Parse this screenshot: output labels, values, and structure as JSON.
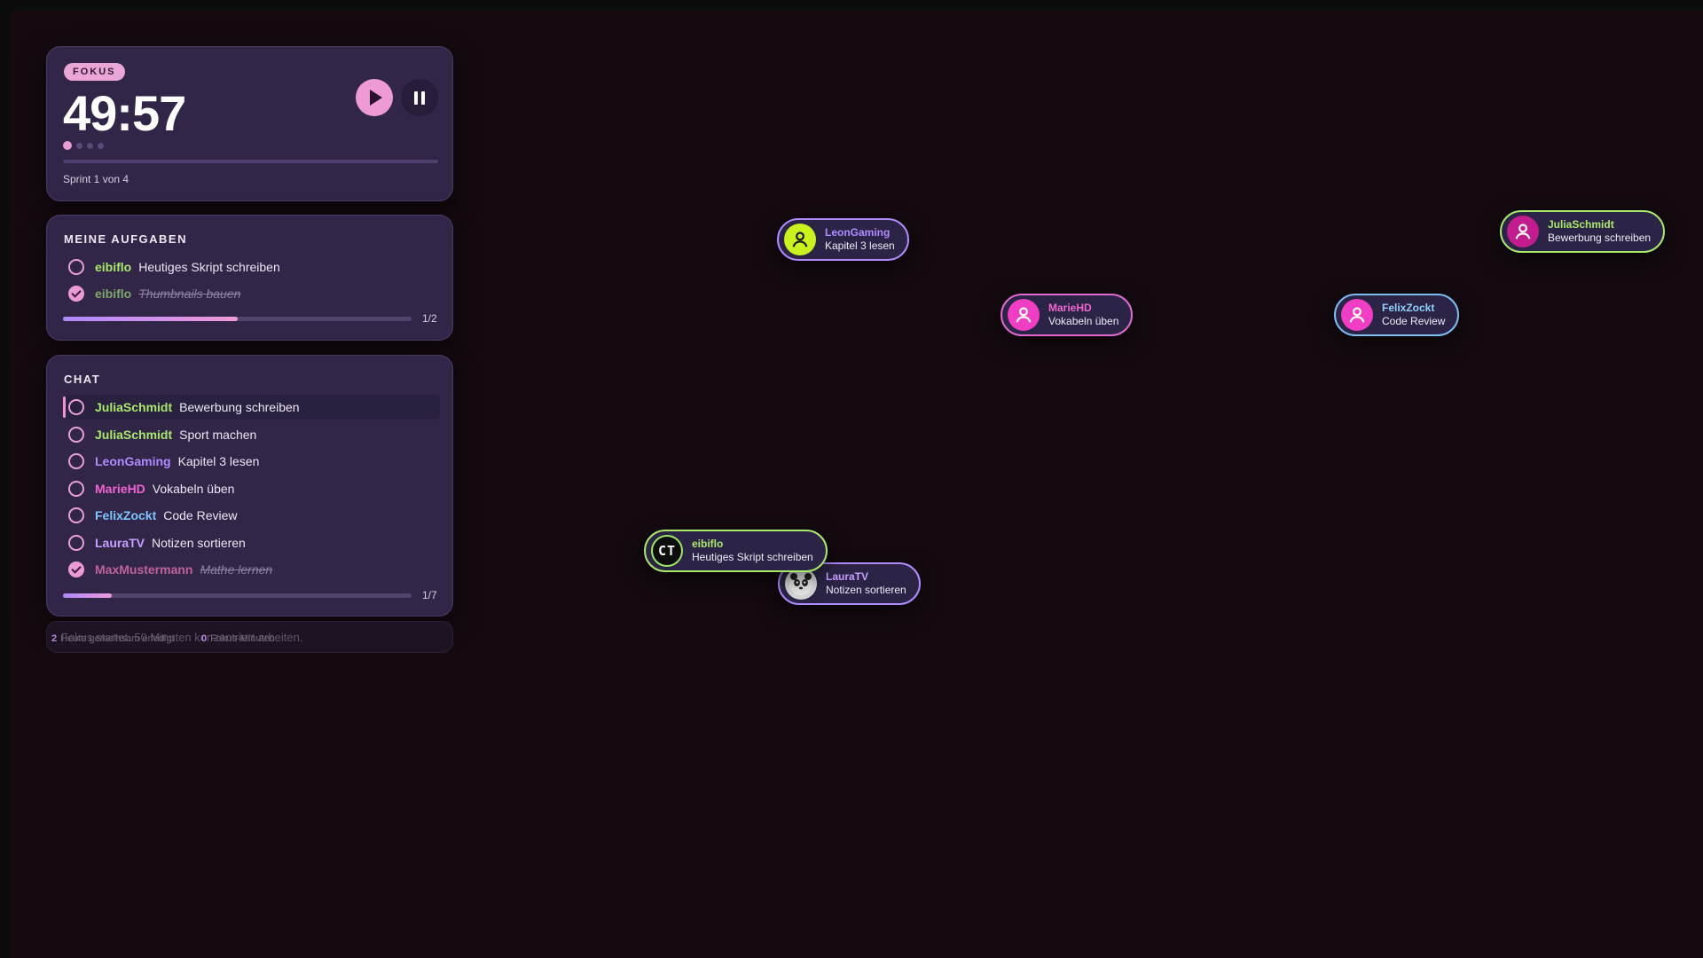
{
  "timer": {
    "mode_label": "FOKUS",
    "time": "49:57",
    "sprint_label": "Sprint 1 von 4",
    "sprint_dots": [
      true,
      false,
      false,
      false
    ],
    "progress": 0.0
  },
  "tasks": {
    "title": "MEINE AUFGABEN",
    "items": [
      {
        "user": "eibiflo",
        "text": "Heutiges Skript schreiben",
        "done": false
      },
      {
        "user": "eibiflo",
        "text": "Thumbnails bauen",
        "done": true
      }
    ],
    "progress_label": "1/2",
    "progress": 0.5
  },
  "chat": {
    "title": "CHAT",
    "items": [
      {
        "user": "JuliaSchmidt",
        "text": "Bewerbung schreiben",
        "done": false,
        "color": "#a9e86b"
      },
      {
        "user": "JuliaSchmidt",
        "text": "Sport machen",
        "done": false,
        "color": "#a9e86b"
      },
      {
        "user": "LeonGaming",
        "text": "Kapitel 3 lesen",
        "done": false,
        "color": "#b08cff"
      },
      {
        "user": "MarieHD",
        "text": "Vokabeln üben",
        "done": false,
        "color": "#f066d0"
      },
      {
        "user": "FelixZockt",
        "text": "Code Review",
        "done": false,
        "color": "#7dc6ff"
      },
      {
        "user": "LauraTV",
        "text": "Notizen sortieren",
        "done": false,
        "color": "#c7a0ff"
      },
      {
        "user": "MaxMustermann",
        "text": "Mathe lernen",
        "done": true,
        "color": "#c0649a"
      }
    ],
    "progress_label": "1/7",
    "progress": 0.14
  },
  "stats": {
    "ghost_message": "Fokus startet. 50 Minuten konzentriert arbeiten.",
    "done_count": "2",
    "done_label": "Heute gemeinsam erledigt",
    "focus_count": "0",
    "focus_label": "Fokus-Minuten"
  },
  "canvas_users": [
    {
      "name": "LeonGaming",
      "task": "Kapitel 3 lesen",
      "name_color": "#b08cff",
      "border": "#b08cff",
      "avatar": "person-icon",
      "avatar_bg": "#c9f21f",
      "icon_color": "#1b1b1b"
    },
    {
      "name": "MarieHD",
      "task": "Vokabeln üben",
      "name_color": "#f066d0",
      "border": "#e06ad0",
      "avatar": "person-icon",
      "avatar_bg": "#f03ec4",
      "icon_color": "#ffffff"
    },
    {
      "name": "FelixZockt",
      "task": "Code Review",
      "name_color": "#8fd0ff",
      "border": "#7dbdf2",
      "avatar": "person-icon",
      "avatar_bg": "#f03ec4",
      "icon_color": "#ffffff"
    },
    {
      "name": "JuliaSchmidt",
      "task": "Bewerbung schreiben",
      "name_color": "#a9e86b",
      "border": "#a9e86b",
      "avatar": "person-icon",
      "avatar_bg": "#c21d8e",
      "icon_color": "#ffffff"
    },
    {
      "name": "eibiflo",
      "task": "Heutiges Skript schreiben",
      "name_color": "#a9e86b",
      "border": "#a9e86b",
      "avatar": "ct-logo",
      "avatar_text": "CT"
    },
    {
      "name": "LauraTV",
      "task": "Notizen sortieren",
      "name_color": "#c7a0ff",
      "border": "#b08cff",
      "avatar": "panda-icon"
    }
  ]
}
